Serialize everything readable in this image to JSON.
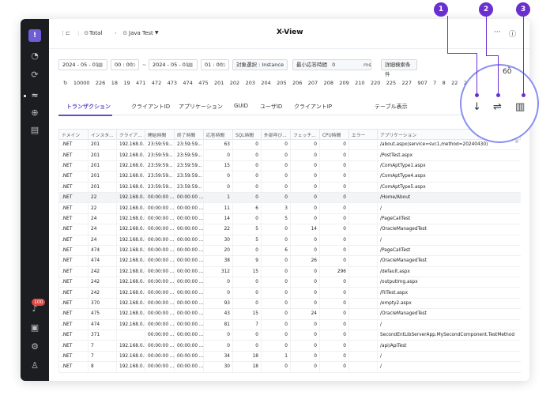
{
  "sidebar": {
    "logo": "!",
    "badge": "100"
  },
  "topbar": {
    "crumb1": "Total",
    "crumb2": "Java Test",
    "title": "X-View"
  },
  "controls": {
    "date_from": "2024 - 05 - 01",
    "time_from": "00 : 00",
    "date_to": "2024 - 05 - 01",
    "time_to": "01 : 00",
    "target_label": "対象選択 :",
    "target_value": "Instance",
    "min_resp_label": "最小応答時間",
    "min_resp_value": "0",
    "min_resp_unit": "ms",
    "detail_search": "詳細検索条件",
    "zoom_top": "0",
    "zoom_value": "60"
  },
  "counts": [
    "10000",
    "226",
    "18",
    "19",
    "471",
    "472",
    "473",
    "474",
    "475",
    "201",
    "202",
    "203",
    "204",
    "205",
    "206",
    "207",
    "208",
    "209",
    "210",
    "220",
    "225",
    "227",
    "907",
    "7",
    "8",
    "22",
    "23"
  ],
  "tabs": [
    "トランザクション",
    "クライアントID",
    "アプリケーション",
    "GUID",
    "ユーザID",
    "クライアントIP",
    "テーブル表示"
  ],
  "table": {
    "headers": [
      "ドメイン",
      "インスタ...",
      "クライア...",
      "開始時間",
      "終了時間",
      "応答時間",
      "SQL時間",
      "外部呼び...",
      "フェッチ...",
      "CPU時間",
      "エラー",
      "アプリケーション"
    ],
    "rows": [
      [
        ".NET",
        "201",
        "192.168.0....",
        "23:59:59...",
        "23:59:59...",
        "63",
        "0",
        "0",
        "0",
        "0",
        "",
        "/about.aspx(service=svc1,method=20240430)"
      ],
      [
        ".NET",
        "201",
        "192.168.0....",
        "23:59:59...",
        "23:59:59...",
        "0",
        "0",
        "0",
        "0",
        "0",
        "",
        "/PostTest.aspx"
      ],
      [
        ".NET",
        "201",
        "192.168.0....",
        "23:59:59...",
        "23:59:59...",
        "15",
        "0",
        "0",
        "0",
        "0",
        "",
        "/ComAptType1.aspx"
      ],
      [
        ".NET",
        "201",
        "192.168.0....",
        "23:59:59...",
        "23:59:59...",
        "0",
        "0",
        "0",
        "0",
        "0",
        "",
        "/ComAptType4.aspx"
      ],
      [
        ".NET",
        "201",
        "192.168.0....",
        "23:59:59...",
        "23:59:59...",
        "0",
        "0",
        "0",
        "0",
        "0",
        "",
        "/ComAptType5.aspx"
      ],
      [
        ".NET",
        "22",
        "192.168.0.8",
        "00:00:00 ...",
        "00:00:00 ...",
        "1",
        "0",
        "0",
        "0",
        "0",
        "",
        "/Home/About"
      ],
      [
        ".NET",
        "22",
        "192.168.0.8",
        "00:00:00 ...",
        "00:00:00 ...",
        "11",
        "6",
        "3",
        "0",
        "0",
        "",
        "/"
      ],
      [
        ".NET",
        "24",
        "192.168.0.8",
        "00:00:00 ...",
        "00:00:00 ...",
        "14",
        "0",
        "5",
        "0",
        "0",
        "",
        "/PageCallTest"
      ],
      [
        ".NET",
        "24",
        "192.168.0.8",
        "00:00:00 ...",
        "00:00:00 ...",
        "22",
        "5",
        "0",
        "14",
        "0",
        "",
        "/OracleManagedTest"
      ],
      [
        ".NET",
        "24",
        "192.168.0.8",
        "00:00:00 ...",
        "00:00:00 ...",
        "30",
        "5",
        "0",
        "0",
        "0",
        "",
        "/"
      ],
      [
        ".NET",
        "474",
        "192.168.0.8",
        "00:00:00 ...",
        "00:00:00 ...",
        "20",
        "0",
        "6",
        "0",
        "0",
        "",
        "/PageCallTest"
      ],
      [
        ".NET",
        "474",
        "192.168.0.8",
        "00:00:00 ...",
        "00:00:00 ...",
        "38",
        "9",
        "0",
        "26",
        "0",
        "",
        "/OracleManagedTest"
      ],
      [
        ".NET",
        "242",
        "192.168.0.8",
        "00:00:00 ...",
        "00:00:00 ...",
        "312",
        "15",
        "0",
        "0",
        "296",
        "",
        "/default.aspx"
      ],
      [
        ".NET",
        "242",
        "192.168.0.8",
        "00:00:00 ...",
        "00:00:00 ...",
        "0",
        "0",
        "0",
        "0",
        "0",
        "",
        "/outputImg.aspx"
      ],
      [
        ".NET",
        "242",
        "192.168.0.8",
        "00:00:00 ...",
        "00:00:00 ...",
        "0",
        "0",
        "0",
        "0",
        "0",
        "",
        "/FilTest.aspx"
      ],
      [
        ".NET",
        "370",
        "192.168.0.8",
        "00:00:00 ...",
        "00:00:00 ...",
        "93",
        "0",
        "0",
        "0",
        "0",
        "",
        "/empty2.aspx"
      ],
      [
        ".NET",
        "475",
        "192.168.0.8",
        "00:00:00 ...",
        "00:00:00 ...",
        "43",
        "15",
        "0",
        "24",
        "0",
        "",
        "/OracleManagedTest"
      ],
      [
        ".NET",
        "474",
        "192.168.0.8",
        "00:00:00 ...",
        "00:00:00 ...",
        "81",
        "7",
        "0",
        "0",
        "0",
        "",
        "/"
      ],
      [
        ".NET",
        "371",
        "",
        "00:00:00 ...",
        "00:00:00 ...",
        "0",
        "0",
        "0",
        "0",
        "0",
        "",
        "SecondEntLibServerApp.MySecondComponent.TestMethod"
      ],
      [
        ".NET",
        "7",
        "192.168.0.8",
        "00:00:00 ...",
        "00:00:00 ...",
        "0",
        "0",
        "0",
        "0",
        "0",
        "",
        "/api/ApiTest"
      ],
      [
        ".NET",
        "7",
        "192.168.0.8",
        "00:00:00 ...",
        "00:00:00 ...",
        "34",
        "18",
        "1",
        "0",
        "0",
        "",
        "/"
      ],
      [
        ".NET",
        "8",
        "192.168.0.8",
        "00:00:00 ...",
        "00:00:00 ...",
        "30",
        "18",
        "0",
        "0",
        "0",
        "",
        "/"
      ]
    ]
  },
  "markers": [
    "1",
    "2",
    "3"
  ]
}
